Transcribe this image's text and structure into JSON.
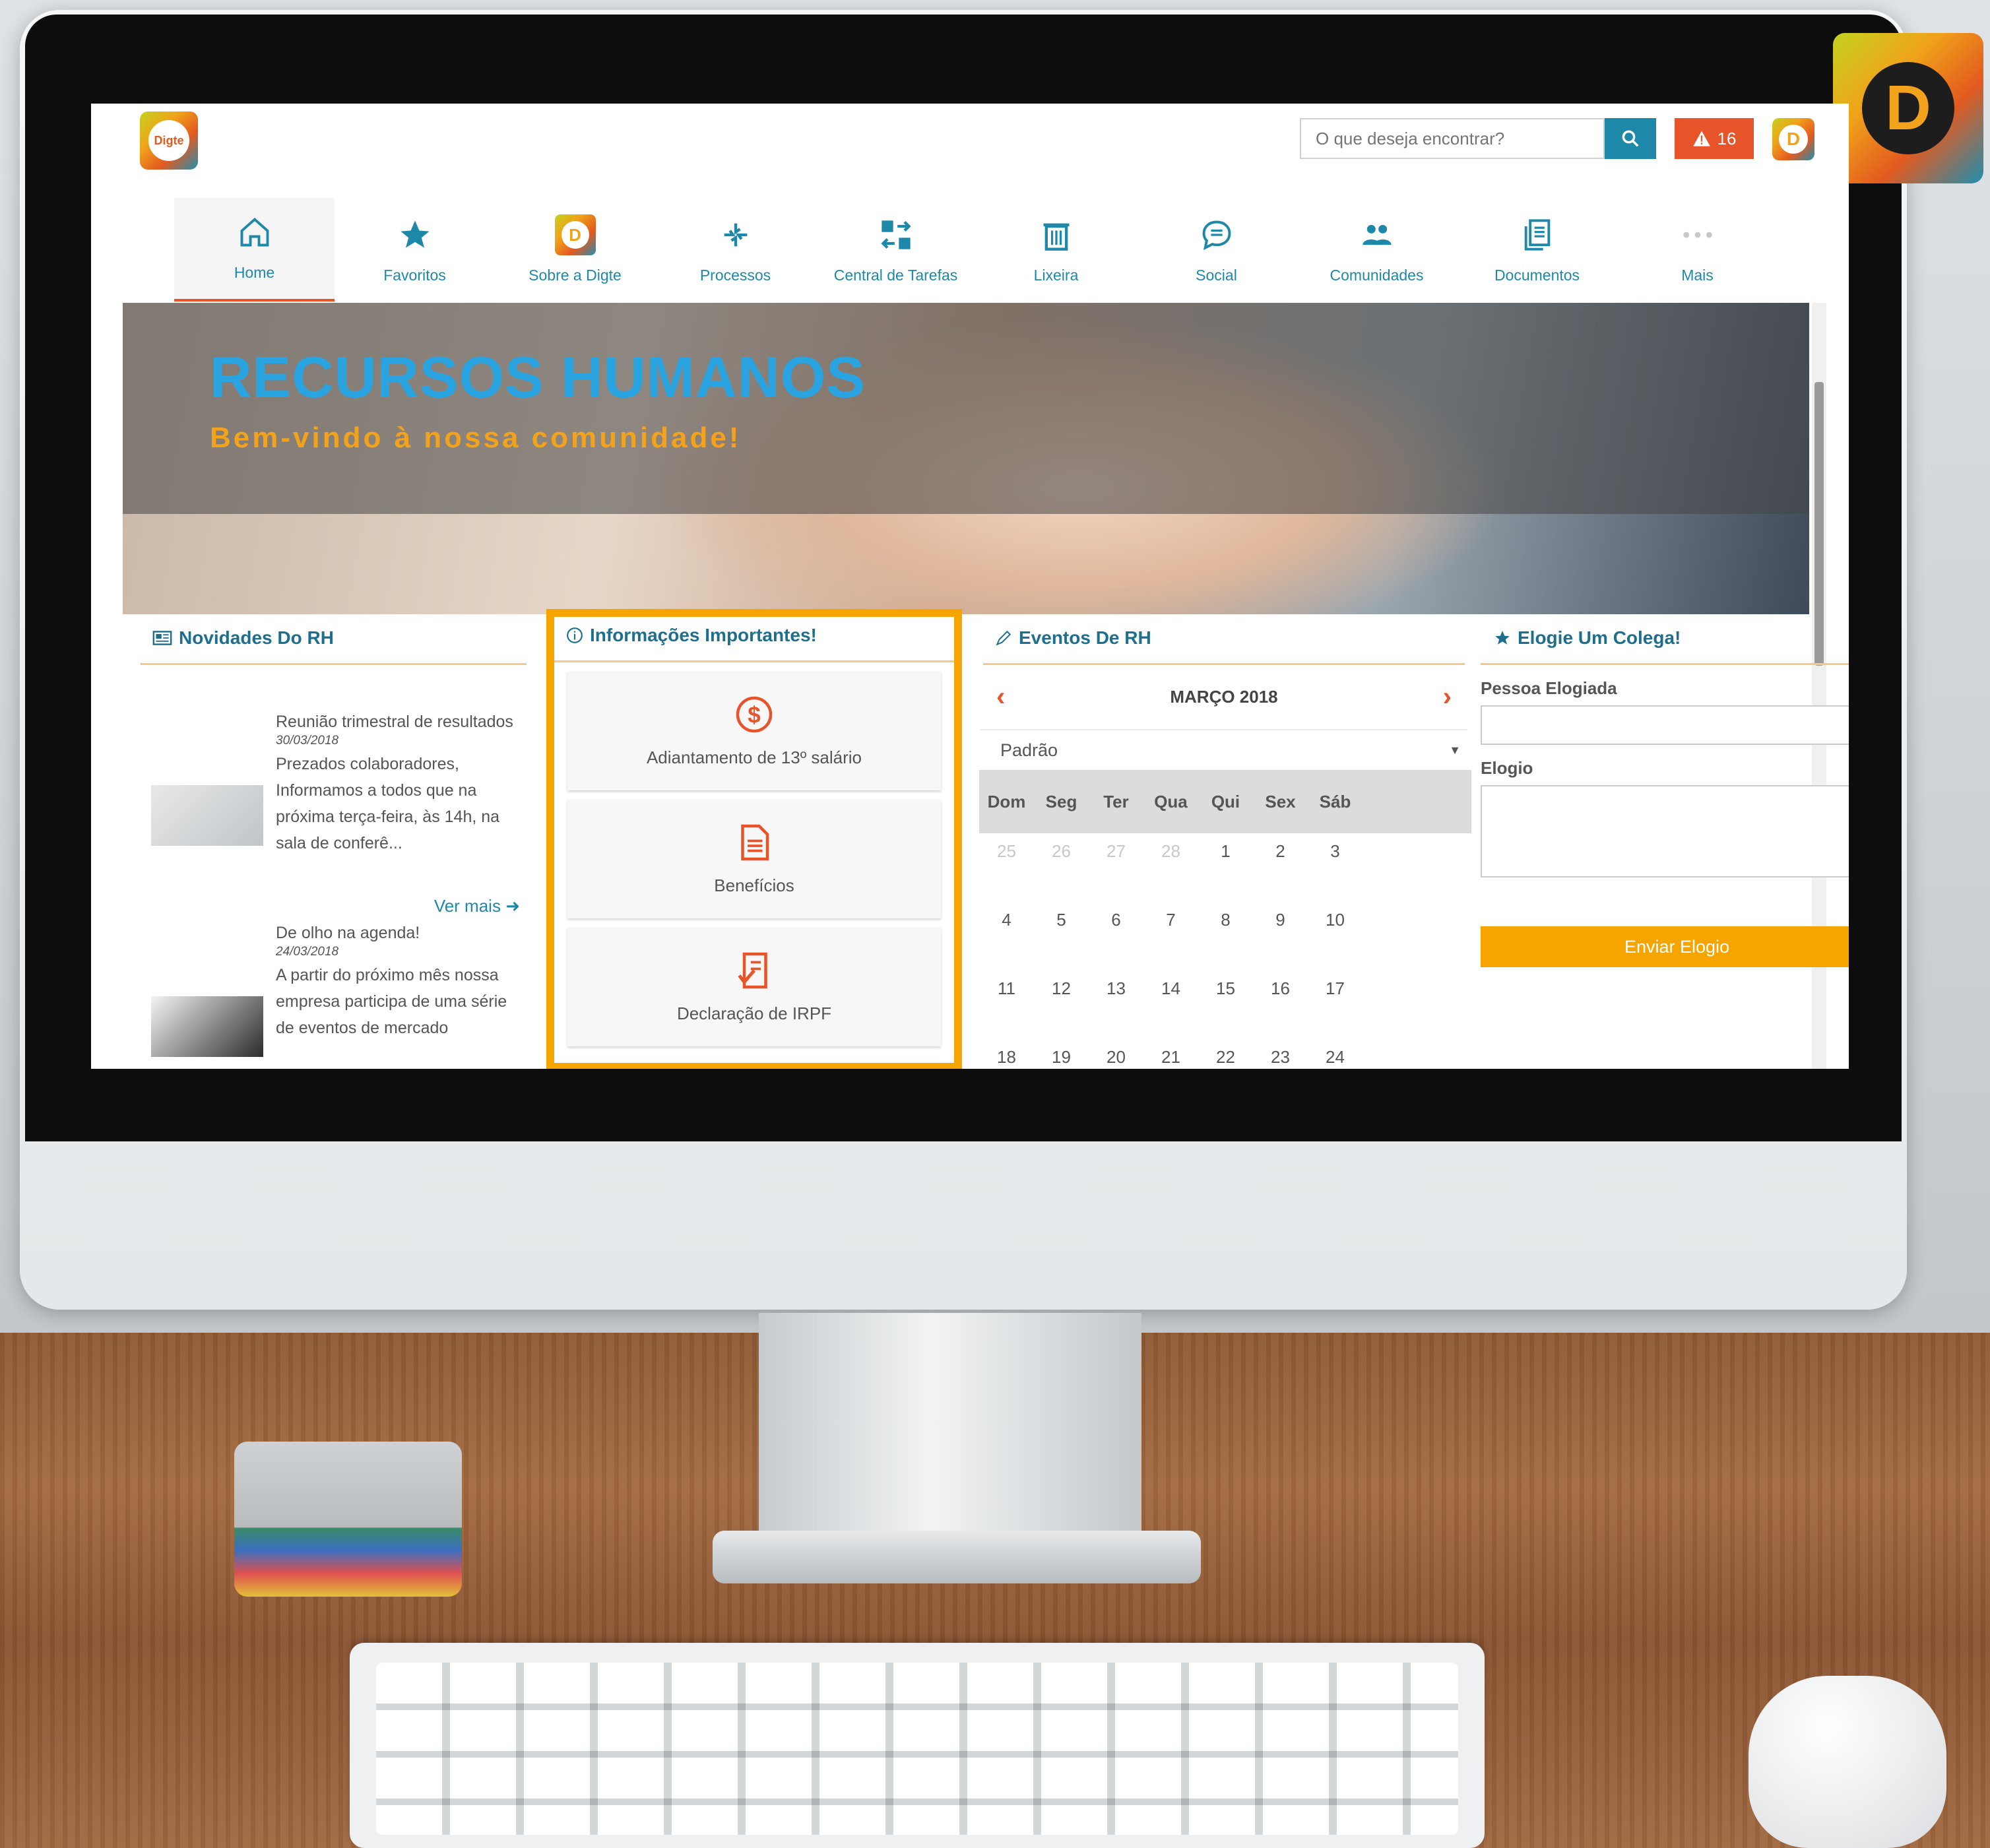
{
  "brand": {
    "logo_text": "Digte",
    "badge_letter": "D"
  },
  "search": {
    "placeholder": "O que deseja encontrar?"
  },
  "alerts": {
    "count": "16"
  },
  "nav": [
    {
      "label": "Home"
    },
    {
      "label": "Favoritos"
    },
    {
      "label": "Sobre a Digte"
    },
    {
      "label": "Processos"
    },
    {
      "label": "Central de Tarefas"
    },
    {
      "label": "Lixeira"
    },
    {
      "label": "Social"
    },
    {
      "label": "Comunidades"
    },
    {
      "label": "Documentos"
    },
    {
      "label": "Mais"
    }
  ],
  "hero": {
    "title": "RECURSOS HUMANOS",
    "subtitle": "Bem-vindo à nossa comunidade!"
  },
  "news": {
    "title": "Novidades Do RH",
    "items": [
      {
        "title": "Reunião trimestral de resultados",
        "date": "30/03/2018",
        "text": "Prezados colaboradores, Informamos a todos que na próxima terça-feira, às 14h, na sala de conferê...",
        "more": "Ver mais"
      },
      {
        "title": "De olho na agenda!",
        "date": "24/03/2018",
        "text": "A partir do próximo mês nossa empresa participa de uma série de eventos de mercado"
      }
    ]
  },
  "info": {
    "title": "Informações Importantes!",
    "cards": [
      {
        "label": "Adiantamento de 13º salário"
      },
      {
        "label": "Benefícios"
      },
      {
        "label": "Declaração de IRPF"
      }
    ]
  },
  "events": {
    "title": "Eventos De RH",
    "month": "MARÇO 2018",
    "view": "Padrão",
    "weekdays": [
      "Dom",
      "Seg",
      "Ter",
      "Qua",
      "Qui",
      "Sex",
      "Sáb"
    ],
    "weeks": [
      [
        "25",
        "26",
        "27",
        "28",
        "1",
        "2",
        "3"
      ],
      [
        "4",
        "5",
        "6",
        "7",
        "8",
        "9",
        "10"
      ],
      [
        "11",
        "12",
        "13",
        "14",
        "15",
        "16",
        "17"
      ],
      [
        "18",
        "19",
        "20",
        "21",
        "22",
        "23",
        "24"
      ]
    ]
  },
  "praise": {
    "title": "Elogie Um Colega!",
    "person_label": "Pessoa Elogiada",
    "praise_label": "Elogio",
    "send_label": "Enviar Elogio"
  },
  "colors": {
    "accent": "#1e88a8",
    "alert": "#e8542a",
    "highlight": "#f6a400"
  }
}
